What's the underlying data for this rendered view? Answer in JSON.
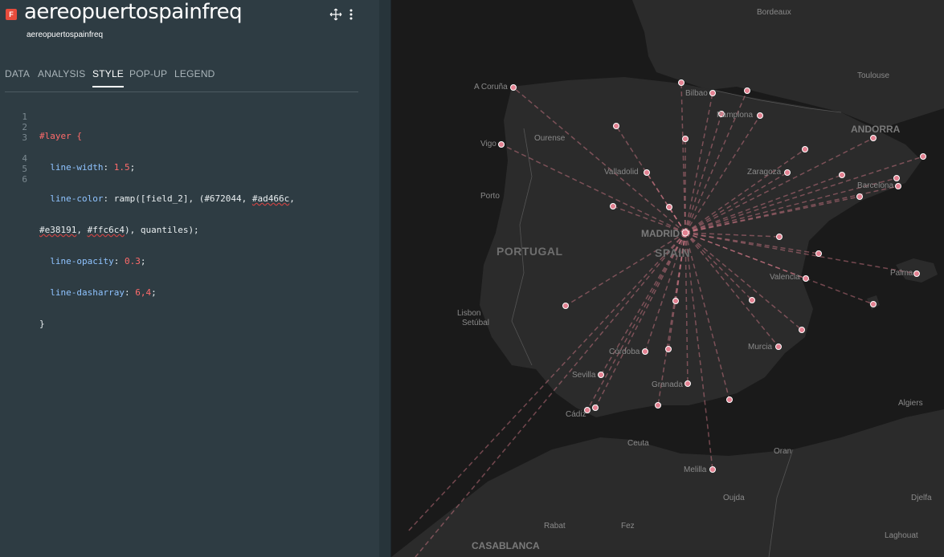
{
  "layer": {
    "badge": "F",
    "title": "aereopuertospainfreq",
    "subtitle": "aereopuertospainfreq",
    "move_icon": "move-icon",
    "menu_icon": "more-vertical-icon"
  },
  "tabs": [
    "DATA",
    "ANALYSIS",
    "STYLE",
    "POP-UP",
    "LEGEND"
  ],
  "active_tab": "STYLE",
  "code": {
    "line_numbers": [
      "1",
      "2",
      "3",
      "",
      "4",
      "5",
      "6"
    ],
    "l1": "#layer {",
    "l2_prop": "  line-width",
    "l2_val": "1.5",
    "l3_prop": "  line-color",
    "l3_a": ": ramp([field_2], (#672044, ",
    "l3_b": "#ad466c",
    "l3_c": ",",
    "l4_a": "#e38191",
    "l4_b": ", ",
    "l4_c": "#ffc6c4",
    "l4_d": "), quantiles);",
    "l5_prop": "  line-opacity",
    "l5_val": "0.3",
    "l6_prop": "  line-dasharray",
    "l6_val": "6,4",
    "l7": "}"
  },
  "map": {
    "colors": {
      "land": "#2b2b2b",
      "sea": "#1a1a1a",
      "line": "#e38191",
      "dot": "#e38191"
    },
    "labels": {
      "bordeaux": "Bordeaux",
      "toulouse": "Toulouse",
      "andorra": "ANDORRA",
      "a_coruna": "A Coruña",
      "ourense": "Ourense",
      "vigo": "Vigo",
      "porto": "Porto",
      "portugal": "PORTUGAL",
      "bilbao": "Bilbao",
      "pamplona": "Pamplona",
      "valladolid": "Valladolid",
      "zaragoza": "Zaragoza",
      "barcelona": "Barcelona",
      "madrid": "MADRID",
      "spain": "SPAIN",
      "valencia": "Valencia",
      "palma": "Palma",
      "lisbon": "Lisbon",
      "setubal": "Setúbal",
      "cordoba": "Córdoba",
      "murcia": "Murcia",
      "sevilla": "Sevilla",
      "granada": "Granada",
      "cadiz": "Cádiz",
      "ceuta": "Ceuta",
      "melilla": "Melilla",
      "algiers": "Algiers",
      "oran": "Oran",
      "oujda": "Oujda",
      "rabat": "Rabat",
      "fez": "Fez",
      "djelfa": "Djelfa",
      "casablanca": "CASABLANCA",
      "laghouat": "Laghouat"
    }
  }
}
